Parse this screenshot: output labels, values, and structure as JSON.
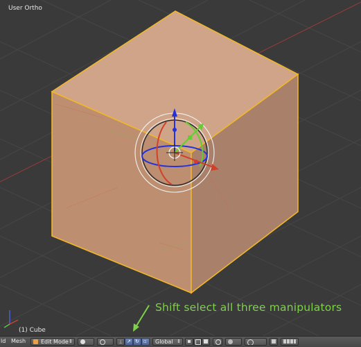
{
  "viewport": {
    "view_name": "User Ortho",
    "object_name": "(1) Cube"
  },
  "annotation": {
    "text": "Shift select all three manipulators",
    "color": "#7ed14a"
  },
  "header": {
    "menu_cut": "ld",
    "mesh_menu": "Mesh",
    "mode_select": "Edit Mode",
    "orientation_select": "Global"
  },
  "colors": {
    "cube_face": "#b88c70",
    "cube_edge": "#f0b62c",
    "x_axis": "#d0402a",
    "y_axis": "#66cc33",
    "z_axis": "#2233dd"
  },
  "icons": [
    "view-editor-icon",
    "shading-solid-icon",
    "pivot-icon",
    "manipulator-toggle-icon",
    "translate-manipulator-icon",
    "rotate-manipulator-icon",
    "scale-manipulator-icon",
    "vertex-select-icon",
    "edge-select-icon",
    "face-select-icon",
    "occlude-icon",
    "proportional-icon",
    "snap-icon",
    "render-icon",
    "layers-icon"
  ]
}
